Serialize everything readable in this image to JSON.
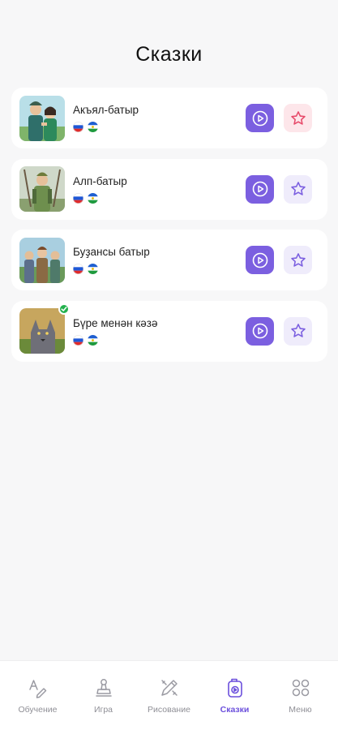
{
  "header": {
    "title": "Сказки"
  },
  "tales": [
    {
      "title": "Акъял-батыр",
      "languages": [
        "ru",
        "ba"
      ],
      "favorite": true,
      "completed": false
    },
    {
      "title": "Алп-батыр",
      "languages": [
        "ru",
        "ba"
      ],
      "favorite": false,
      "completed": false
    },
    {
      "title": "Буҙансы батыр",
      "languages": [
        "ru",
        "ba"
      ],
      "favorite": false,
      "completed": false
    },
    {
      "title": "Бүре менән кәзә",
      "languages": [
        "ru",
        "ba"
      ],
      "favorite": false,
      "completed": true
    }
  ],
  "nav": {
    "items": [
      {
        "label": "Обучение",
        "icon": "learn-icon"
      },
      {
        "label": "Игра",
        "icon": "game-icon"
      },
      {
        "label": "Рисование",
        "icon": "drawing-icon"
      },
      {
        "label": "Сказки",
        "icon": "tales-icon",
        "active": true
      },
      {
        "label": "Меню",
        "icon": "menu-icon"
      }
    ]
  },
  "colors": {
    "accent": "#7b5fe0",
    "fav_active": "#e74a6a",
    "nav_active": "#6b4fdc",
    "badge": "#23b14d"
  }
}
